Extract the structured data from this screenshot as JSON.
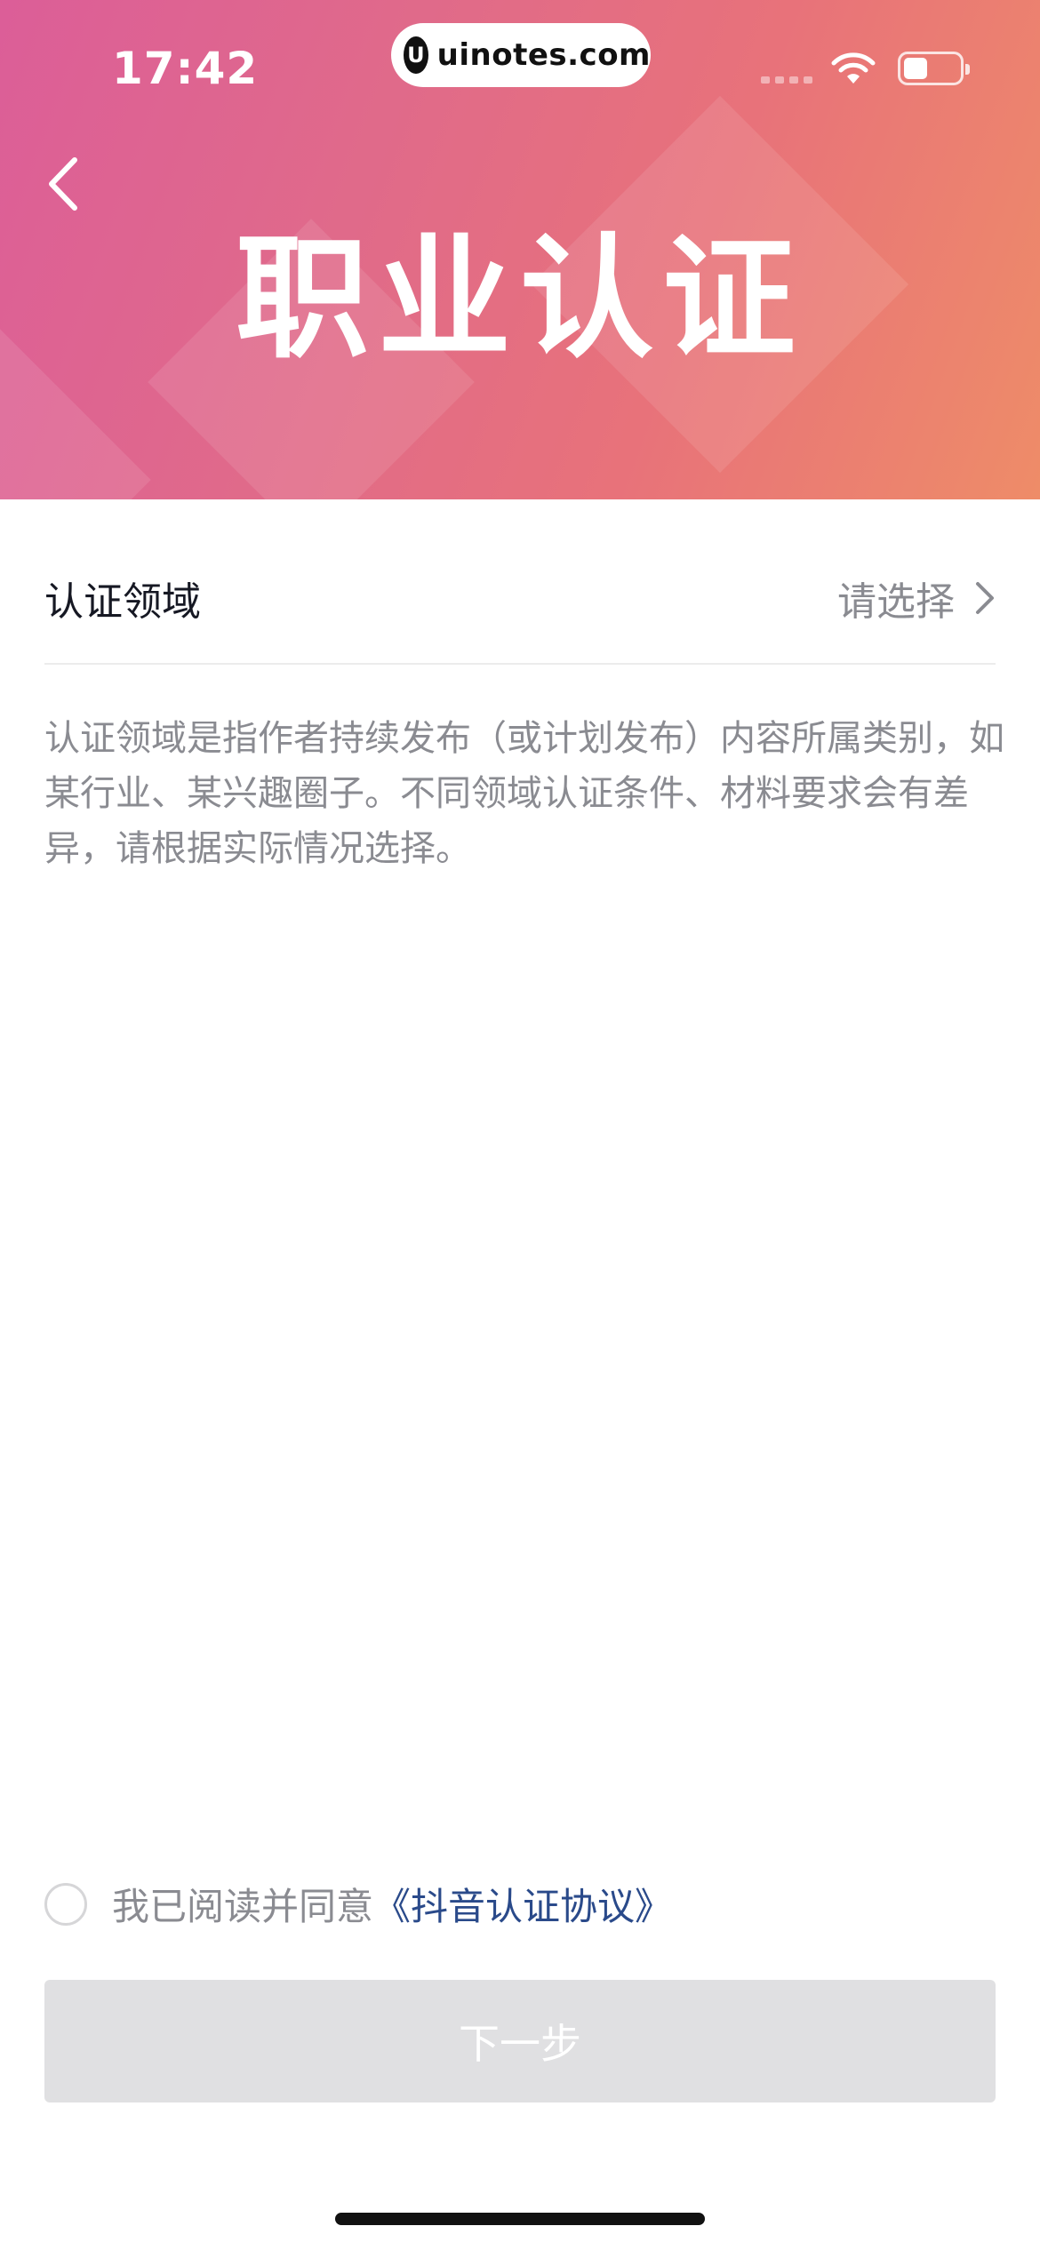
{
  "status_bar": {
    "time": "17:42",
    "url": "uinotes.com",
    "url_logo": "U"
  },
  "header": {
    "title": "职业认证",
    "back_icon": "chevron-left-icon",
    "gradient_colors": [
      "#dc5e98",
      "#ee8c68"
    ]
  },
  "field": {
    "label": "认证领域",
    "placeholder": "请选择"
  },
  "description": "认证领域是指作者持续发布（或计划发布）内容所属类别，如某行业、某兴趣圈子。不同领域认证条件、材料要求会有差异，请根据实际情况选择。",
  "agreement": {
    "text": "我已阅读并同意",
    "link": "《抖音认证协议》",
    "link_color": "#2a4a8a"
  },
  "next_button": {
    "label": "下一步"
  }
}
